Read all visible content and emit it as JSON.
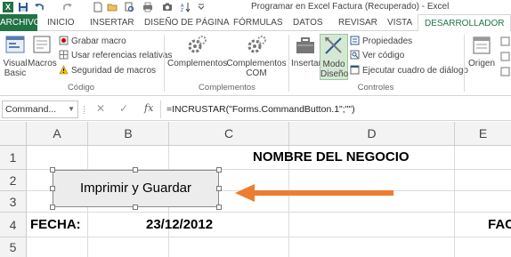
{
  "window": {
    "title": "Programar en Excel Factura (Recuperado) - Excel"
  },
  "quick_access": {
    "icons": [
      "excel-app-icon",
      "save-icon",
      "undo-icon",
      "redo-icon",
      "new-document-icon",
      "open-folder-icon",
      "print-preview-icon",
      "print-icon",
      "camera-icon",
      "sort-icon",
      "customize-icon"
    ]
  },
  "tabs": [
    {
      "label": "ARCHIVO"
    },
    {
      "label": "INICIO"
    },
    {
      "label": "INSERTAR"
    },
    {
      "label": "DISEÑO DE PÁGINA"
    },
    {
      "label": "FÓRMULAS"
    },
    {
      "label": "DATOS"
    },
    {
      "label": "REVISAR"
    },
    {
      "label": "VISTA"
    },
    {
      "label": "DESARROLLADOR"
    }
  ],
  "ribbon": {
    "codigo": {
      "label": "Código",
      "visual_basic": "Visual\nBasic",
      "macros": "Macros",
      "grabar_macro": "Grabar macro",
      "usar_referencias": "Usar referencias relativas",
      "seguridad": "Seguridad de macros"
    },
    "complementos": {
      "label": "Complementos",
      "complementos": "Complementos",
      "complementos_com": "Complementos\nCOM"
    },
    "controles": {
      "label": "Controles",
      "insertar": "Insertar",
      "modo_diseno": "Modo\nDiseño",
      "propiedades": "Propiedades",
      "ver_codigo": "Ver código",
      "ejecutar_cuadro": "Ejecutar cuadro de diálogo"
    },
    "xml": {
      "origen": "Origen"
    }
  },
  "formula_bar": {
    "name_box": "Command...",
    "fx": "fx",
    "formula": "=INCRUSTAR(\"Forms.CommandButton.1\";\"\")"
  },
  "sheet": {
    "columns": [
      "A",
      "B",
      "C",
      "D",
      "E"
    ],
    "rows": [
      "1",
      "2",
      "3",
      "4",
      "5"
    ],
    "cells": {
      "title": "NOMBRE DEL NEGOCIO",
      "fecha_label": "FECHA:",
      "fecha_value": "23/12/2012",
      "e4_partial": "FAC"
    }
  },
  "embedded_button": {
    "label": "Imprimir y Guardar"
  },
  "colors": {
    "excel_green": "#217346",
    "arrow_orange": "#ed7d31"
  }
}
